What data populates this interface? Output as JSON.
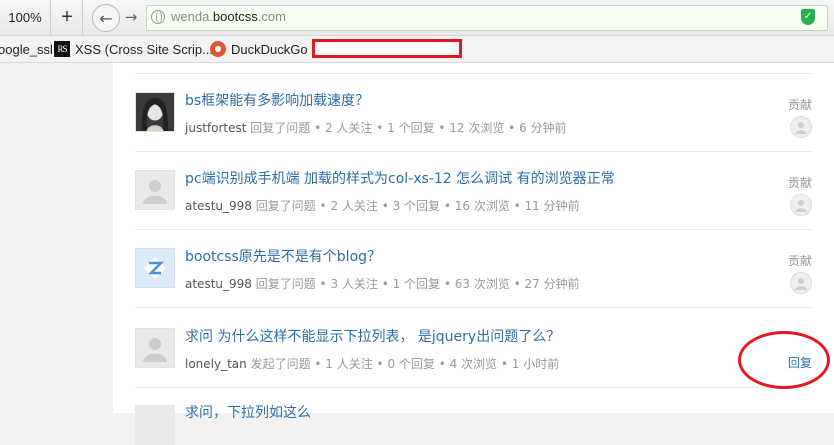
{
  "browser": {
    "zoom": "100%",
    "new_tab_symbol": "+",
    "url_host": "wenda.",
    "url_domain": "bootcss",
    "url_tld": ".com",
    "bookmarks": [
      {
        "label": "oogle_ssl"
      },
      {
        "label": "XSS (Cross Site Scrip..."
      },
      {
        "label": "DuckDuckGo"
      }
    ]
  },
  "labels": {
    "contribute": "贡献",
    "reply": "回复"
  },
  "questions": [
    {
      "title": "bs框架能有多影响加载速度？",
      "user": "justfortest",
      "meta": " 回复了问题 • 2 人关注 • 1 个回复 • 12 次浏览 • 6 分钟前"
    },
    {
      "title": "pc端识别成手机端 加载的样式为col-xs-12 怎么调试 有的浏览器正常",
      "user": "atestu_998",
      "meta": " 回复了问题 • 2 人关注 • 3 个回复 • 16 次浏览 • 11 分钟前"
    },
    {
      "title": "bootcss原先是不是有个blog？",
      "user": "atestu_998",
      "meta": " 回复了问题 • 3 人关注 • 1 个回复 • 63 次浏览 • 27 分钟前"
    },
    {
      "title": "求问 为什么这样不能显示下拉列表， 是jquery出问题了么？",
      "user": "lonely_tan",
      "meta": " 发起了问题 • 1 人关注 • 0 个回复 • 4 次浏览 • 1 小时前"
    }
  ],
  "partial_title": "求问，下拉列如这么"
}
